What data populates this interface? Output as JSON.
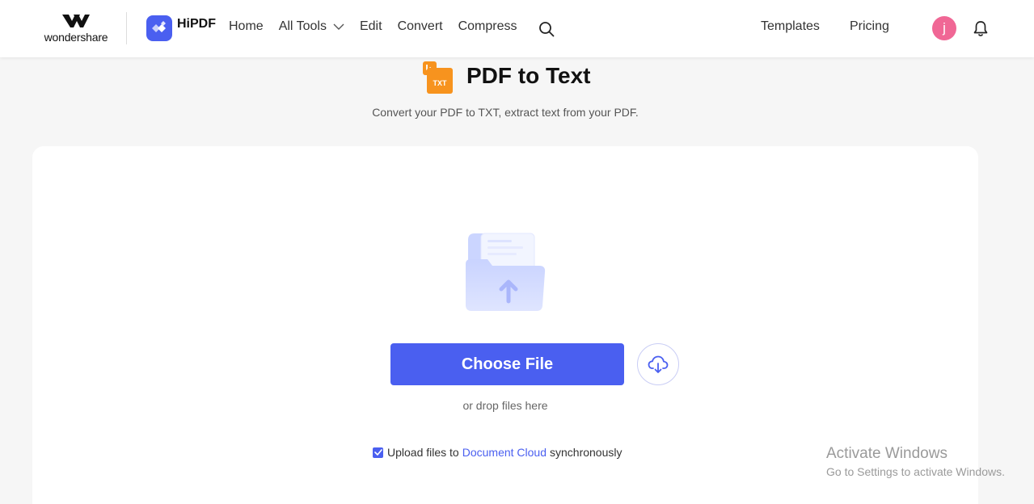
{
  "brand": {
    "company": "wondershare",
    "product": "HiPDF"
  },
  "nav": {
    "items": [
      "Home",
      "All Tools",
      "Edit",
      "Convert",
      "Compress"
    ],
    "templates": "Templates",
    "pricing": "Pricing",
    "avatar_letter": "j"
  },
  "page": {
    "icon_label": "TXT",
    "title": "PDF to Text",
    "subtitle": "Convert your PDF to TXT, extract text from your PDF."
  },
  "upload": {
    "choose_label": "Choose File",
    "drop_hint": "or drop files here",
    "sync_prefix": "Upload files to",
    "sync_link": "Document Cloud",
    "sync_suffix": "synchronously",
    "sync_checked": true
  },
  "watermark": {
    "title": "Activate Windows",
    "subtitle": "Go to Settings to activate Windows."
  },
  "colors": {
    "accent": "#4a5ff0",
    "avatar": "#f06795",
    "tool_icon": "#f7931e"
  }
}
